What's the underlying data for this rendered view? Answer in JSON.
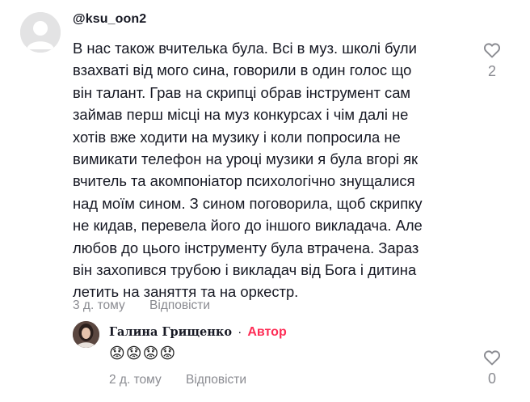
{
  "comment": {
    "username": "@ksu_oon2",
    "text": "В нас також вчителька була. Всі в муз. школі були\nвзахваті від мого сина, говорили в один голос що\nвін талант. Грав на скрипці обрав інструмент сам\nзаймав перш місці на муз конкурсах і чім далі не\nхотів вже ходити на музику і коли попросила не\nвимикати телефон на уроці музики я була вгорі як\nвчитель та акомпоніатор психологічно знущалися\nнад моїм сином. З сином поговорила, щоб скрипку\nне кидав, перевела його до іншого викладача. Але\nлюбов до цього інструменту була втрачена. Зараз\nвін захопився трубою і викладач від Бога і дитина\nлетить на заняття та на оркестр.",
    "time": "3 д. тому",
    "reply_label": "Відповісти",
    "like_count": "2",
    "like_icon": "heart-outline-icon"
  },
  "reply": {
    "author": "Галина Грищенко",
    "separator": "·",
    "badge": "Автор",
    "text": "😟😟😟😟",
    "time": "2 д. тому",
    "reply_label": "Відповісти",
    "like_count": "0",
    "like_icon": "heart-outline-icon"
  },
  "colors": {
    "text": "#161823",
    "muted": "#8a8b91",
    "author_badge": "#fe2c55",
    "avatar_placeholder": "#e3e3e4"
  }
}
